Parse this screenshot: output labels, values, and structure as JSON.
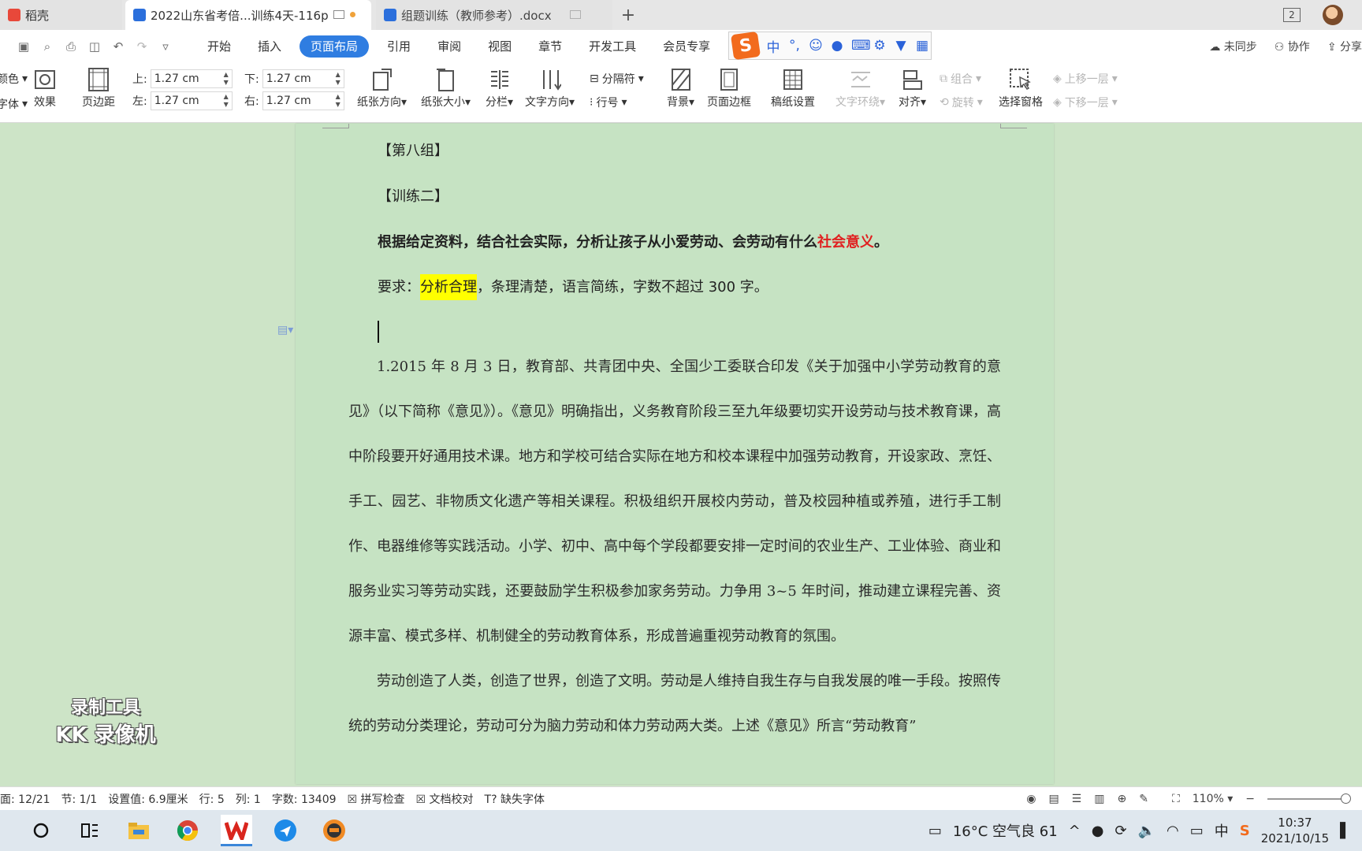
{
  "tabs": [
    {
      "label": "稻壳"
    },
    {
      "label": "2022山东省考倍...训练4天-116p"
    },
    {
      "label": "组题训练（教师参考）.docx"
    }
  ],
  "menu": [
    "开始",
    "插入",
    "页面布局",
    "引用",
    "审阅",
    "视图",
    "章节",
    "开发工具",
    "会员专享"
  ],
  "menu_active": "页面布局",
  "menu_right": {
    "sync": "未同步",
    "collab": "协作",
    "share": "分享"
  },
  "ime": {
    "mode": "中",
    "punct": "°,"
  },
  "ribbon": {
    "color_cut": "颜色",
    "font_cut": "字体",
    "effect": "效果",
    "margin": "页边距",
    "top_label": "上:",
    "top_value": "1.27 cm",
    "bottom_label": "下:",
    "bottom_value": "1.27 cm",
    "left_label": "左:",
    "left_value": "1.27 cm",
    "right_label": "右:",
    "right_value": "1.27 cm",
    "orientation": "纸张方向",
    "size": "纸张大小",
    "columns": "分栏",
    "text_dir": "文字方向",
    "separator": "分隔符",
    "line_no": "行号",
    "background": "背景",
    "border": "页面边框",
    "grid": "稿纸设置",
    "wrap": "文字环绕",
    "align": "对齐",
    "group": "组合",
    "rotate": "旋转",
    "select_pane": "选择窗格",
    "bring_up": "上移一层",
    "send_down": "下移一层"
  },
  "document": {
    "group_heading": "【第八组】",
    "training": "【训练二】",
    "question_black": "根据给定资料，结合社会实际，分析让孩子从小爱劳动、会劳动有什么",
    "question_red": "社会意义",
    "question_end": "。",
    "req_prefix": "要求：",
    "req_highlight": "分析合理",
    "req_rest": "，条理清楚，语言简练，字数不超过 300 字。",
    "para1": "1.2015 年 8 月 3 日，教育部、共青团中央、全国少工委联合印发《关于加强中小学劳动教育的意见》（以下简称《意见》）。《意见》明确指出，义务教育阶段三至九年级要切实开设劳动与技术教育课，高中阶段要开好通用技术课。地方和学校可结合实际在地方和校本课程中加强劳动教育，开设家政、烹饪、手工、园艺、非物质文化遗产等相关课程。积极组织开展校内劳动，普及校园种植或养殖，进行手工制作、电器维修等实践活动。小学、初中、高中每个学段都要安排一定时间的农业生产、工业体验、商业和服务业实习等劳动实践，还要鼓励学生积极参加家务劳动。力争用 3~5 年时间，推动建立课程完善、资源丰富、模式多样、机制健全的劳动教育体系，形成普遍重视劳动教育的氛围。",
    "para2": "劳动创造了人类，创造了世界，创造了文明。劳动是人维持自我生存与自我发展的唯一手段。按照传统的劳动分类理论，劳动可分为脑力劳动和体力劳动两大类。上述《意见》所言“劳动教育”"
  },
  "watermark": {
    "line1": "录制工具",
    "line2": "KK 录像机"
  },
  "status": {
    "page": "面: 12/21",
    "section": "节: 1/1",
    "setting": "设置值: 6.9厘米",
    "row": "行: 5",
    "col": "列: 1",
    "words": "字数: 13409",
    "spell": "拼写检查",
    "proof": "文档校对",
    "missing_font": "缺失字体",
    "zoom": "110%"
  },
  "taskbar": {
    "weather": "16°C 空气良 61",
    "ime": "中",
    "time": "10:37",
    "date": "2021/10/15"
  }
}
